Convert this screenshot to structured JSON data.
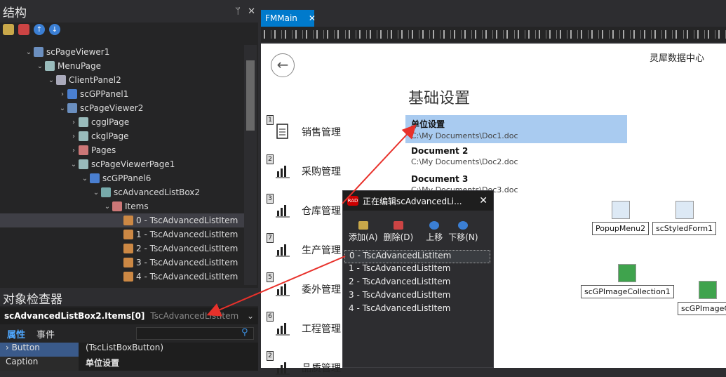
{
  "structure": {
    "title": "结构",
    "pin": "ᛘ",
    "close": "✕",
    "tree": [
      {
        "label": "scPageViewer1",
        "level": 2,
        "chev": "⌄",
        "ic": "#6b8fbf"
      },
      {
        "label": "MenuPage",
        "level": 3,
        "chev": "⌄",
        "ic": "#9bb"
      },
      {
        "label": "ClientPanel2",
        "level": 4,
        "chev": "⌄",
        "ic": "#aab"
      },
      {
        "label": "scGPPanel1",
        "level": 5,
        "chev": "›",
        "ic": "#4a7fd0"
      },
      {
        "label": "scPageViewer2",
        "level": 5,
        "chev": "⌄",
        "ic": "#6b8fbf"
      },
      {
        "label": "cgglPage",
        "level": 6,
        "chev": "›",
        "ic": "#9bb"
      },
      {
        "label": "ckglPage",
        "level": 6,
        "chev": "›",
        "ic": "#9bb"
      },
      {
        "label": "Pages",
        "level": 6,
        "chev": "›",
        "ic": "#c77"
      },
      {
        "label": "scPageViewerPage1",
        "level": 6,
        "chev": "⌄",
        "ic": "#9bb"
      },
      {
        "label": "scGPPanel6",
        "level": 7,
        "chev": "⌄",
        "ic": "#4a7fd0"
      },
      {
        "label": "scAdvancedListBox2",
        "level": 8,
        "chev": "⌄",
        "ic": "#7aa"
      },
      {
        "label": "Items",
        "level": 9,
        "chev": "⌄",
        "ic": "#c77"
      },
      {
        "label": "0 - TscAdvancedListItem",
        "level": 10,
        "chev": "",
        "ic": "#c84",
        "sel": true
      },
      {
        "label": "1 - TscAdvancedListItem",
        "level": 10,
        "chev": "",
        "ic": "#c84"
      },
      {
        "label": "2 - TscAdvancedListItem",
        "level": 10,
        "chev": "",
        "ic": "#c84"
      },
      {
        "label": "3 - TscAdvancedListItem",
        "level": 10,
        "chev": "",
        "ic": "#c84"
      },
      {
        "label": "4 - TscAdvancedListItem",
        "level": 10,
        "chev": "",
        "ic": "#c84"
      }
    ]
  },
  "inspector": {
    "title": "对象检查器",
    "selected": "scAdvancedListBox2.Items[0]",
    "selected_type": "TscAdvancedListItem",
    "tab_props": "属性",
    "tab_events": "事件",
    "props": [
      {
        "k": "Button",
        "v": "(TscListBoxButton)",
        "expand": "›"
      },
      {
        "k": "Caption",
        "v": "单位设置",
        "bold": true
      }
    ]
  },
  "editor": {
    "tab_title": "FMMain",
    "tab_close": "✕",
    "company": "灵犀数据中心",
    "heading": "基础设置",
    "nav": [
      "销售管理",
      "采购管理",
      "仓库管理",
      "生产管理",
      "委外管理",
      "工程管理",
      "品质管理"
    ],
    "nav_badges": [
      "1",
      "2",
      "3",
      "7",
      "5",
      "6",
      "2"
    ],
    "docs": [
      {
        "h": "单位设置",
        "p": "C:\\My Documents\\Doc1.doc"
      },
      {
        "h": "Document 2",
        "p": "C:\\My Documents\\Doc2.doc"
      },
      {
        "h": "Document 3",
        "p": "C:\\My Documents\\Doc3.doc"
      }
    ],
    "components": [
      {
        "label": "PopupMenu2"
      },
      {
        "label": "scStyledForm1"
      },
      {
        "label": "scGPImageCollection1"
      },
      {
        "label": "scGPImageCo"
      }
    ]
  },
  "dialog": {
    "title": "正在编辑scAdvancedLi...",
    "close": "✕",
    "rad": "RAD",
    "buttons": [
      "添加(A)",
      "删除(D)",
      "上移",
      "下移(N)"
    ],
    "items": [
      "0 - TscAdvancedListItem",
      "1 - TscAdvancedListItem",
      "2 - TscAdvancedListItem",
      "3 - TscAdvancedListItem",
      "4 - TscAdvancedListItem"
    ]
  },
  "colors": {
    "accent": "#007acc",
    "arrow": "#e8312b"
  }
}
